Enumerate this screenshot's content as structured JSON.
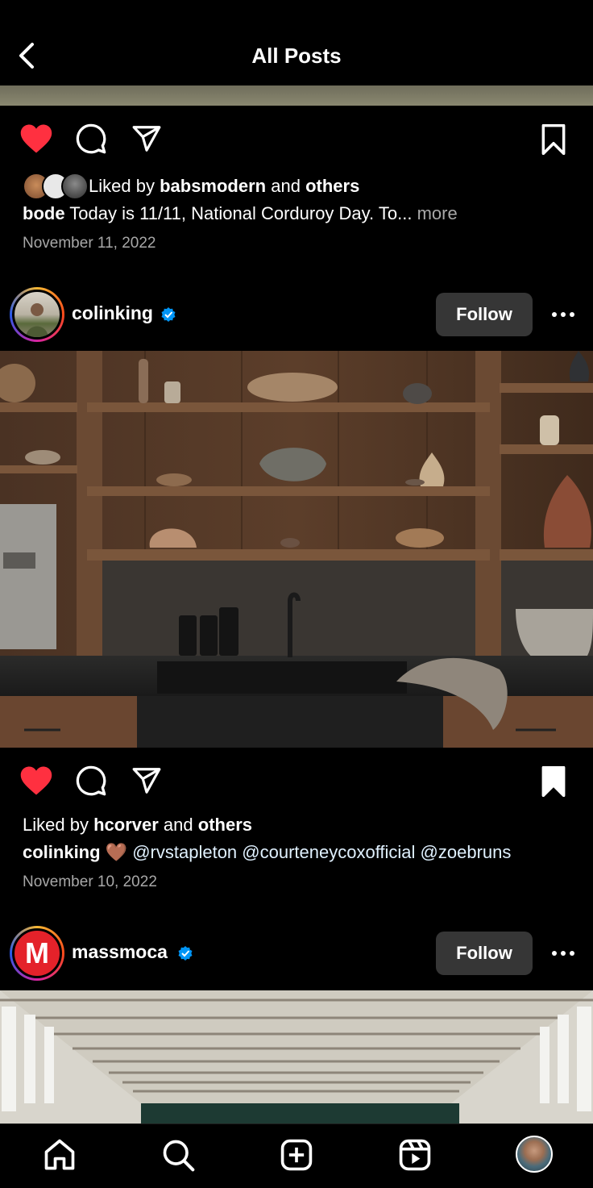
{
  "header": {
    "title": "All Posts"
  },
  "post1": {
    "liked_by_prefix": "Liked by",
    "liked_by_user": "babsmodern",
    "and": "and",
    "others": "others",
    "caption_user": "bode",
    "caption_text": "Today is 11/11, National Corduroy Day. To...",
    "more": "more",
    "date": "November 11, 2022",
    "liked": true,
    "saved": false
  },
  "post2": {
    "username": "colinking",
    "verified": true,
    "follow_label": "Follow",
    "liked_by_prefix": "Liked by",
    "liked_by_user": "hcorver",
    "and": "and",
    "others": "others",
    "caption_user": "colinking",
    "caption_emoji": "🤎",
    "caption_text": "@rvstapleton @courteneycoxofficial @zoebruns",
    "date": "November 10, 2022",
    "liked": true,
    "saved": true
  },
  "post3": {
    "username": "massmoca",
    "verified": true,
    "follow_label": "Follow",
    "avatar_letter": "M"
  },
  "nav": {
    "items": [
      "home-icon",
      "search-icon",
      "create-icon",
      "reels-icon",
      "profile-avatar"
    ]
  },
  "colors": {
    "like": "#ff3040",
    "verified": "#0095f6",
    "follow_bg": "#363636",
    "massmoca_red": "#e4222a"
  }
}
